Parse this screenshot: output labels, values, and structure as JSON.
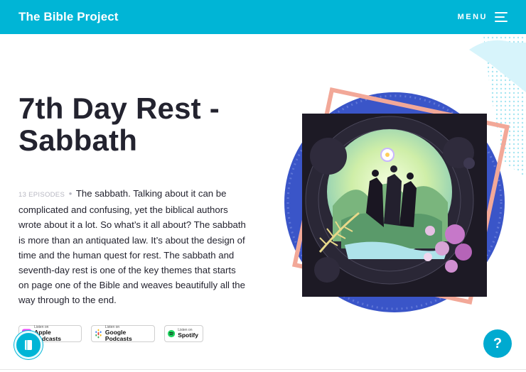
{
  "header": {
    "brand": "The Bible Project",
    "menu_label": "MENU",
    "menu_icon": "hamburger-icon"
  },
  "main": {
    "title_line1": "7th Day Rest -",
    "title_line2": "Sabbath",
    "episodes": "13 EPISODES",
    "separator": "•",
    "description": "The sabbath. Talking about it can be complicated and confusing, yet the biblical authors wrote about it a lot. So what’s it all about? The sabbath is more than an antiquated law. It’s about the design of time and the human quest for rest. The sabbath and seventh-day rest is one of the key themes that starts on page one of the Bible and weaves beautifully all the way through to the end."
  },
  "badges": [
    {
      "small": "Listen on",
      "big": "Apple Podcasts",
      "icon": "apple-podcasts-icon"
    },
    {
      "small": "Listen on",
      "big": "Google Podcasts",
      "icon": "google-podcasts-icon"
    },
    {
      "small": "Listen on",
      "big": "Spotify",
      "icon": "spotify-icon"
    }
  ],
  "fabs": {
    "help_label": "?",
    "book_icon": "book-icon"
  },
  "colors": {
    "header_bg": "#00b5d6",
    "title": "#23232f",
    "accent_blue": "#3a55c8",
    "accent_pink": "#f2a898"
  }
}
